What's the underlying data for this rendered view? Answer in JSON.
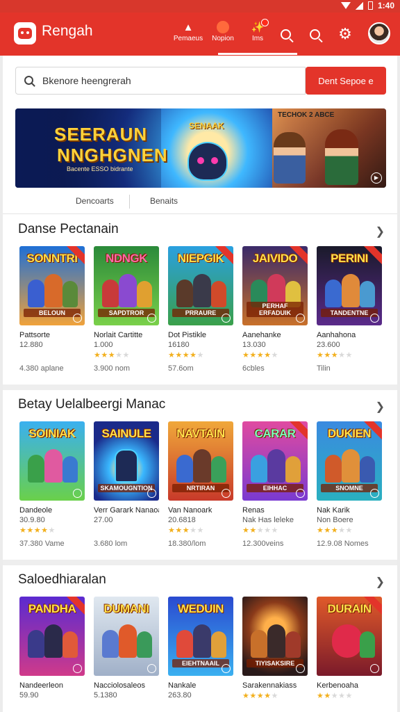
{
  "status_bar": {
    "time": "1:40"
  },
  "app_bar": {
    "title": "Rengah",
    "tabs": [
      {
        "label": "Pemaeus",
        "icon": "joystick-icon"
      },
      {
        "label": "Nopion",
        "icon": "ball-icon"
      },
      {
        "label": "Ims",
        "icon": "notification-icon"
      }
    ],
    "icons": [
      "discover-icon",
      "search-icon",
      "gear-icon",
      "avatar"
    ]
  },
  "search": {
    "value": "Bkenore heengrerah",
    "button_label": "Dent Sepoe e"
  },
  "banner": {
    "title_line1": "SEERAUN",
    "title_line2": "NNGHGNEN",
    "tagline": "Bacente ESSO bidrante",
    "mid_text": "SENAAK",
    "right_text": "TECHOK   2 ABCE"
  },
  "sub_tabs": [
    "Dencoarts",
    "Benaits"
  ],
  "sections": [
    {
      "title": "Danse Pectanain",
      "items": [
        {
          "thumb_title": "SONNTRI",
          "thumb_foot": "BELOUN",
          "name": "Pattsorte",
          "meta": "12.880",
          "rating": 0,
          "extra": "4.380 aplane"
        },
        {
          "thumb_title": "NDNGK",
          "thumb_foot": "SAPDTROR",
          "name": "Norlait Cartitte",
          "meta": "1.000",
          "rating": 3,
          "extra": "3.900 nom"
        },
        {
          "thumb_title": "NIEPGIK",
          "thumb_foot": "PRRAURE",
          "name": "Dot Pistikle",
          "meta": "16180",
          "rating": 4,
          "extra": "57.6om"
        },
        {
          "thumb_title": "JAIVIDO",
          "thumb_foot": "PERHAF ERFADUIK",
          "name": "Aanehanke",
          "meta": "13.030",
          "rating": 4,
          "extra": "6cbles"
        },
        {
          "thumb_title": "PERINI",
          "thumb_foot": "TANDENTNE",
          "name": "Aanhahona",
          "meta": "23.600",
          "rating": 3,
          "extra": "Tilin"
        }
      ]
    },
    {
      "title": "Betay Uelalbeergi Manac",
      "items": [
        {
          "thumb_title": "SOINIAK",
          "thumb_foot": "",
          "name": "Dandeole",
          "meta": "30.9.80",
          "rating": 4,
          "extra": "37.380 Vame"
        },
        {
          "thumb_title": "SAINULE",
          "thumb_foot": "SKAMOUGNTION",
          "name": "Verr Garark Nanaoan konn",
          "meta": "27.00",
          "rating": 0,
          "extra": "3.680 lom"
        },
        {
          "thumb_title": "NAVTAIN",
          "thumb_foot": "NRTIRAN",
          "name": "Van Nanoark",
          "meta": "20.6818",
          "rating": 3,
          "extra": "18.380/lom"
        },
        {
          "thumb_title": "CARAR",
          "thumb_foot": "EIHHAC",
          "name": "Renas",
          "meta": "Nak Has leleke",
          "rating": 2,
          "extra": "12.300veins"
        },
        {
          "thumb_title": "DUKIEN",
          "thumb_foot": "SNOMNE",
          "name": "Nak Karik",
          "meta": "Non Boere",
          "rating": 3,
          "extra": "12.9.08 Nomes"
        }
      ]
    },
    {
      "title": "Saloedhiaralan",
      "items": [
        {
          "thumb_title": "PANDHA",
          "thumb_foot": "",
          "name": "Nandeerleon",
          "meta": "59.90",
          "rating": 0,
          "extra": ""
        },
        {
          "thumb_title": "DUMANI",
          "thumb_foot": "",
          "name": "Nacciolosaleos",
          "meta": "5.1380",
          "rating": 0,
          "extra": ""
        },
        {
          "thumb_title": "WEDUIN",
          "thumb_foot": "EIEHTNAAIL",
          "name": "Nankale",
          "meta": "263.80",
          "rating": 0,
          "extra": ""
        },
        {
          "thumb_title": "",
          "thumb_foot": "TIYISAKSIRE",
          "name": "Sarakennakiass",
          "meta": "",
          "rating": 4,
          "extra": ""
        },
        {
          "thumb_title": "DURAIN",
          "thumb_foot": "",
          "name": "Kerbenoaha",
          "meta": "",
          "rating": 2,
          "extra": ""
        }
      ]
    }
  ],
  "colors": {
    "brand": "#e3342a",
    "star": "#f2b01e"
  }
}
